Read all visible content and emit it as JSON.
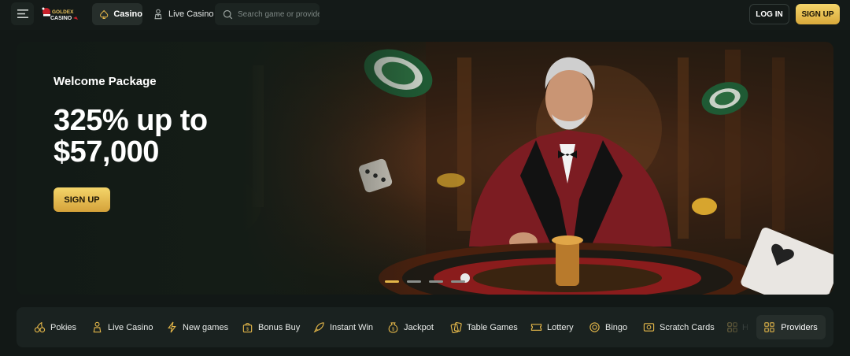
{
  "header": {
    "logo_text": "GOLDEX CASINO",
    "nav": [
      {
        "label": "Casino",
        "icon": "spade-icon"
      },
      {
        "label": "Live Casino",
        "icon": "dealer-icon"
      }
    ],
    "search": {
      "placeholder": "Search game or provider",
      "icon": "search-icon"
    },
    "login_label": "LOG IN",
    "signup_label": "SIGN UP"
  },
  "banner": {
    "label": "Welcome Package",
    "title": "325% up to $57,000",
    "cta_label": "SIGN UP",
    "slides": 4,
    "active_slide": 1
  },
  "categories": [
    {
      "label": "Pokies",
      "icon": "cherry-icon"
    },
    {
      "label": "Live Casino",
      "icon": "dealer-icon"
    },
    {
      "label": "New games",
      "icon": "lightning-icon"
    },
    {
      "label": "Bonus Buy",
      "icon": "gift-bag-icon"
    },
    {
      "label": "Instant Win",
      "icon": "rocket-icon"
    },
    {
      "label": "Jackpot",
      "icon": "coin-bag-icon"
    },
    {
      "label": "Table Games",
      "icon": "cards-icon"
    },
    {
      "label": "Lottery",
      "icon": "ticket-icon"
    },
    {
      "label": "Bingo",
      "icon": "bingo-ball-icon"
    },
    {
      "label": "Scratch Cards",
      "icon": "scratch-card-icon"
    },
    {
      "label": "H",
      "icon": "grid-icon"
    }
  ],
  "providers_label": "Providers",
  "colors": {
    "accent": "#e3b649",
    "bg": "#121816",
    "panel": "#1a2220"
  }
}
